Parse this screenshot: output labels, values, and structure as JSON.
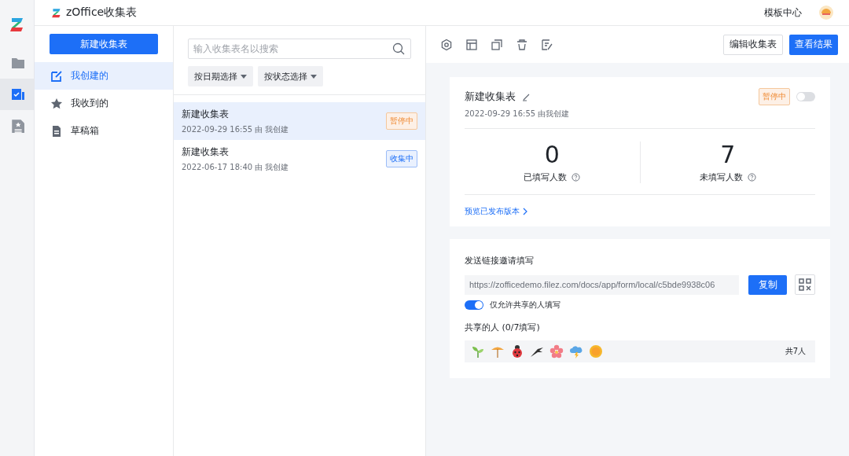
{
  "app": {
    "title": "zOffice收集表",
    "header_link": "模板中心"
  },
  "rail": [
    {
      "kind": "folder",
      "selected": false
    },
    {
      "kind": "form",
      "selected": true
    },
    {
      "kind": "doc",
      "selected": false
    }
  ],
  "sidebar": {
    "new_button": "新建收集表",
    "items": [
      {
        "kind": "edit",
        "label": "我创建的",
        "selected": true
      },
      {
        "kind": "star",
        "label": "我收到的",
        "selected": false
      },
      {
        "kind": "draft",
        "label": "草稿箱",
        "selected": false
      }
    ]
  },
  "list": {
    "search": {
      "placeholder": "输入收集表名以搜索"
    },
    "filters": [
      "按日期选择",
      "按状态选择"
    ],
    "items": [
      {
        "title": "新建收集表",
        "meta": "2022-09-29 16:55 由 我创建",
        "status": "暂停中",
        "kind": "paused",
        "selected": true
      },
      {
        "title": "新建收集表",
        "meta": "2022-06-17 18:40 由 我创建",
        "status": "收集中",
        "kind": "collecting",
        "selected": false
      }
    ]
  },
  "detail": {
    "toolbar": {
      "edit_button": "编辑收集表",
      "results_button": "查看结果"
    },
    "title": "新建收集表",
    "meta": "2022-09-29 16:55 由我创建",
    "status": "暂停中",
    "kind": "paused",
    "collecting_on": false,
    "stats": [
      {
        "value": "0",
        "label": "已填写人数"
      },
      {
        "value": "7",
        "label": "未填写人数"
      }
    ],
    "preview_link": "预览已发布版本",
    "share": {
      "heading": "发送链接邀请填写",
      "url": "https://zofficedemo.filez.com/docs/app/form/local/c5bde9938c06",
      "copy_button": "复制",
      "only_shared": {
        "label": "仅允许共享的人填写",
        "on": true
      },
      "people_heading": "共享的人 (0/7填写)",
      "people": [
        {
          "kind": "sprout"
        },
        {
          "kind": "umbrella"
        },
        {
          "kind": "ladybug"
        },
        {
          "kind": "bird"
        },
        {
          "kind": "flower"
        },
        {
          "kind": "storm"
        },
        {
          "kind": "sun"
        }
      ],
      "people_total": "共7人"
    }
  }
}
